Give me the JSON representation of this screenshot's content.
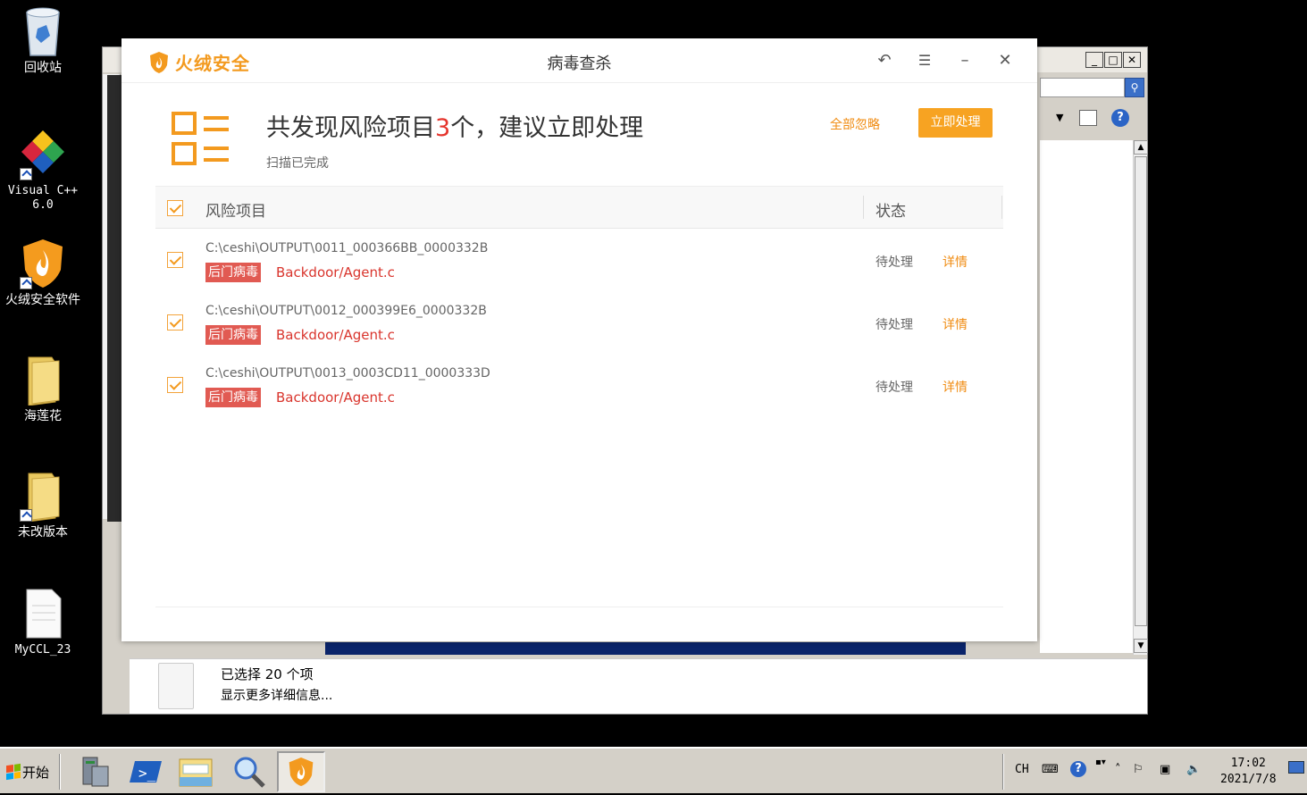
{
  "desktop": {
    "icons": [
      {
        "label": "回收站",
        "icon": "recycle-bin-icon"
      },
      {
        "label": "Visual C++\n6.0",
        "icon": "visual-cpp-icon"
      },
      {
        "label": "火绒安全软件",
        "icon": "huorong-shield-icon"
      },
      {
        "label": "海莲花",
        "icon": "folder-icon"
      },
      {
        "label": "未改版本",
        "icon": "folder-icon"
      },
      {
        "label": "MyCCL_23",
        "icon": "document-icon"
      }
    ]
  },
  "explorer": {
    "details": {
      "selected": "已选择 20 个项",
      "more": "显示更多详细信息..."
    }
  },
  "dialog": {
    "brand": "火绒安全",
    "title": "病毒查杀",
    "summary": {
      "prefix": "共发现风险项目",
      "count": "3",
      "suffix": "个，建议立即处理",
      "status": "扫描已完成"
    },
    "ignore_all": "全部忽略",
    "handle_now": "立即处理",
    "columns": {
      "risk": "风险项目",
      "status": "状态"
    },
    "rows": [
      {
        "path": "C:\\ceshi\\OUTPUT\\0011_000366BB_0000332B",
        "tag": "后门病毒",
        "virus": "Backdoor/Agent.c",
        "status": "待处理",
        "detail": "详情"
      },
      {
        "path": "C:\\ceshi\\OUTPUT\\0012_000399E6_0000332B",
        "tag": "后门病毒",
        "virus": "Backdoor/Agent.c",
        "status": "待处理",
        "detail": "详情"
      },
      {
        "path": "C:\\ceshi\\OUTPUT\\0013_0003CD11_0000333D",
        "tag": "后门病毒",
        "virus": "Backdoor/Agent.c",
        "status": "待处理",
        "detail": "详情"
      }
    ],
    "colors": {
      "accent": "#f39a1f",
      "danger": "#e5342c",
      "tag_bg": "#e15a52"
    }
  },
  "taskbar": {
    "start": "开始",
    "apps": [
      "server-manager-icon",
      "powershell-icon",
      "explorer-icon",
      "search-icon",
      "huorong-icon"
    ],
    "tray": {
      "lang": "CH",
      "time": "17:02",
      "date": "2021/7/8"
    }
  }
}
